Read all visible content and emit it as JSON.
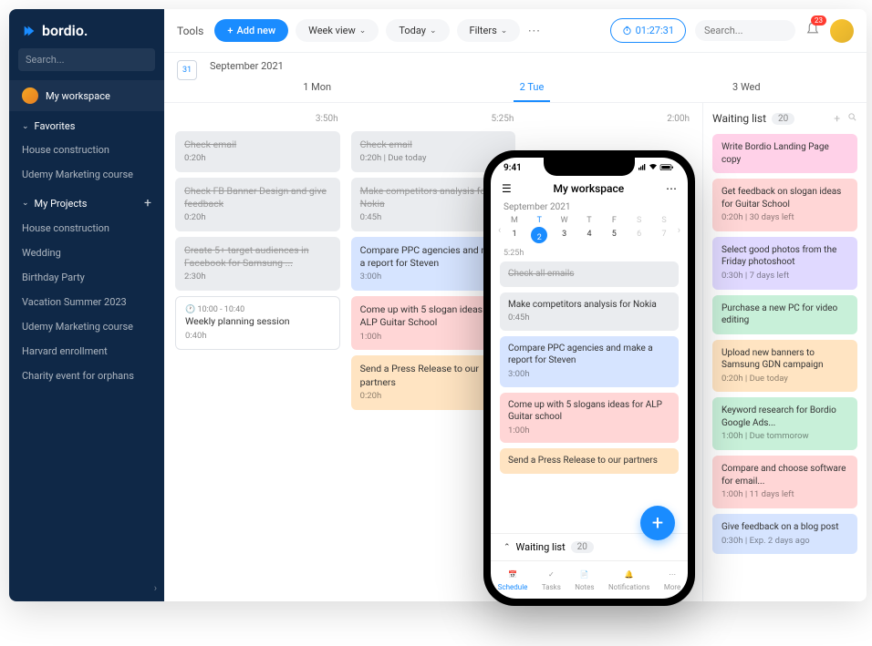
{
  "brand": "bordio.",
  "sidebar": {
    "search_placeholder": "Search...",
    "workspace": "My workspace",
    "favorites_label": "Favorites",
    "favorites": [
      "House construction",
      "Udemy Marketing course"
    ],
    "projects_label": "My Projects",
    "projects": [
      "House construction",
      "Wedding",
      "Birthday Party",
      "Vacation Summer 2023",
      "Udemy Marketing course",
      "Harvard enrollment",
      "Charity event for orphans"
    ]
  },
  "toolbar": {
    "tools": "Tools",
    "add_new": "Add new",
    "week_view": "Week view",
    "today": "Today",
    "filters": "Filters",
    "timer": "01:27:31",
    "search_placeholder": "Search...",
    "notif_count": "23"
  },
  "calendar": {
    "icon_day": "31",
    "month": "September 2021",
    "days": [
      "1 Mon",
      "2 Tue",
      "3 Wed"
    ],
    "active_day_index": 1,
    "hours": [
      "3:50h",
      "5:25h",
      "2:00h"
    ]
  },
  "columns": [
    [
      {
        "title": "Check email",
        "meta": "0:20h",
        "cls": "c-gray done"
      },
      {
        "title": "Check FB Banner Design and give feedback",
        "meta": "0:20h",
        "cls": "c-gray done"
      },
      {
        "title": "Create 5+ target audiences in Facebook for Samsung ...",
        "meta": "2:30h",
        "cls": "c-gray done"
      },
      {
        "title": "Weekly planning session",
        "meta": "0:40h",
        "time": "10:00 - 10:40",
        "cls": "outline"
      }
    ],
    [
      {
        "title": "Check email",
        "meta": "0:20h | Due today",
        "cls": "c-gray done"
      },
      {
        "title": "Make competitors analysis for Nokia",
        "meta": "0:45h",
        "cls": "c-gray done"
      },
      {
        "title": "Compare PPC agencies and make a report for Steven",
        "meta": "3:00h",
        "cls": "c-blue"
      },
      {
        "title": "Come up with 5 slogan ideas for ALP Guitar School",
        "meta": "1:00h",
        "cls": "c-red"
      },
      {
        "title": "Send a Press Release to our partners",
        "meta": "0:20h",
        "cls": "c-orange"
      }
    ],
    []
  ],
  "waiting": {
    "title": "Waiting list",
    "count": "20",
    "items": [
      {
        "title": "Write Bordio Landing Page copy",
        "meta": "",
        "cls": "c-pink"
      },
      {
        "title": "Get feedback on slogan ideas for Guitar School",
        "meta": "0:20h | 30 days left",
        "cls": "c-red"
      },
      {
        "title": "Select good photos from the Friday photoshoot",
        "meta": "0:30h | 7 days left",
        "cls": "c-lav"
      },
      {
        "title": "Purchase a new PC for video editing",
        "meta": "",
        "cls": "c-green"
      },
      {
        "title": "Upload new banners to Samsung GDN campaign",
        "meta": "0:20h | Due today",
        "cls": "c-orange"
      },
      {
        "title": "Keyword research for Bordio Google Ads...",
        "meta": "1:00h | Due tommorow",
        "cls": "c-green"
      },
      {
        "title": "Compare and choose software for email...",
        "meta": "1:00h | 11 days left",
        "cls": "c-red"
      },
      {
        "title": "Give feedback on a blog post",
        "meta": "0:30h | Exp. 2 days ago",
        "cls": "c-blue"
      }
    ]
  },
  "phone": {
    "time": "9:41",
    "title": "My workspace",
    "month": "September 2021",
    "weekdays": [
      "M",
      "T",
      "W",
      "T",
      "F",
      "S",
      "S"
    ],
    "daynums": [
      "1",
      "2",
      "3",
      "4",
      "5",
      "6",
      "7"
    ],
    "sel_index": 1,
    "hours": "5:25h",
    "tasks": [
      {
        "title": "Check all emails",
        "meta": "",
        "cls": "c-gray done"
      },
      {
        "title": "Make competitors analysis for Nokia",
        "meta": "0:45h",
        "cls": "c-gray"
      },
      {
        "title": "Compare PPC agencies and make a report for Steven",
        "meta": "3:00h",
        "cls": "c-blue"
      },
      {
        "title": "Come up with 5 slogans ideas for ALP Guitar school",
        "meta": "1:00h",
        "cls": "c-red"
      },
      {
        "title": "Send a Press Release to our partners",
        "meta": "",
        "cls": "c-orange"
      }
    ],
    "waiting_label": "Waiting list",
    "waiting_count": "20",
    "tabs": [
      "Schedule",
      "Tasks",
      "Notes",
      "Notifications",
      "More"
    ]
  }
}
